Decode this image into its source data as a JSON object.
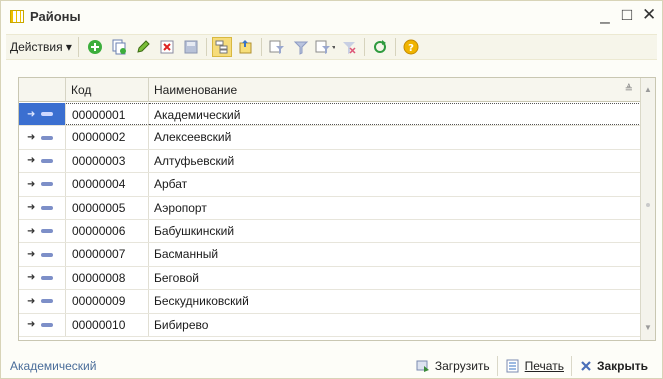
{
  "window": {
    "title": "Районы",
    "icons": [
      "table-icon",
      "minimize-icon",
      "maximize-icon",
      "close-icon"
    ],
    "controls": {
      "minimize": "_",
      "maximize": "□",
      "close": "✕"
    }
  },
  "toolbar": {
    "actions_label": "Действия ▾",
    "buttons": [
      "add-icon",
      "copy-icon",
      "edit-icon",
      "delete-icon",
      "save-icon",
      "hierarchy-icon",
      "move-icon",
      "filter-icon",
      "filter-off-icon",
      "filter-list-icon",
      "clear-filter-icon",
      "refresh-icon",
      "help-icon"
    ],
    "accent": "#3b6fd0"
  },
  "grid": {
    "columns": [
      "",
      "Код",
      "Наименование"
    ],
    "rows": [
      {
        "code": "00000001",
        "name": "Академический",
        "selected": true
      },
      {
        "code": "00000002",
        "name": "Алексеевский"
      },
      {
        "code": "00000003",
        "name": "Алтуфьевский"
      },
      {
        "code": "00000004",
        "name": "Арбат"
      },
      {
        "code": "00000005",
        "name": "Аэропорт"
      },
      {
        "code": "00000006",
        "name": "Бабушкинский"
      },
      {
        "code": "00000007",
        "name": "Басманный"
      },
      {
        "code": "00000008",
        "name": "Беговой"
      },
      {
        "code": "00000009",
        "name": "Бескудниковский"
      },
      {
        "code": "00000010",
        "name": "Бибирево"
      }
    ]
  },
  "status": {
    "current": "Академический",
    "load_label": "Загрузить",
    "print_label": "Печать",
    "close_label": "Закрыть"
  }
}
